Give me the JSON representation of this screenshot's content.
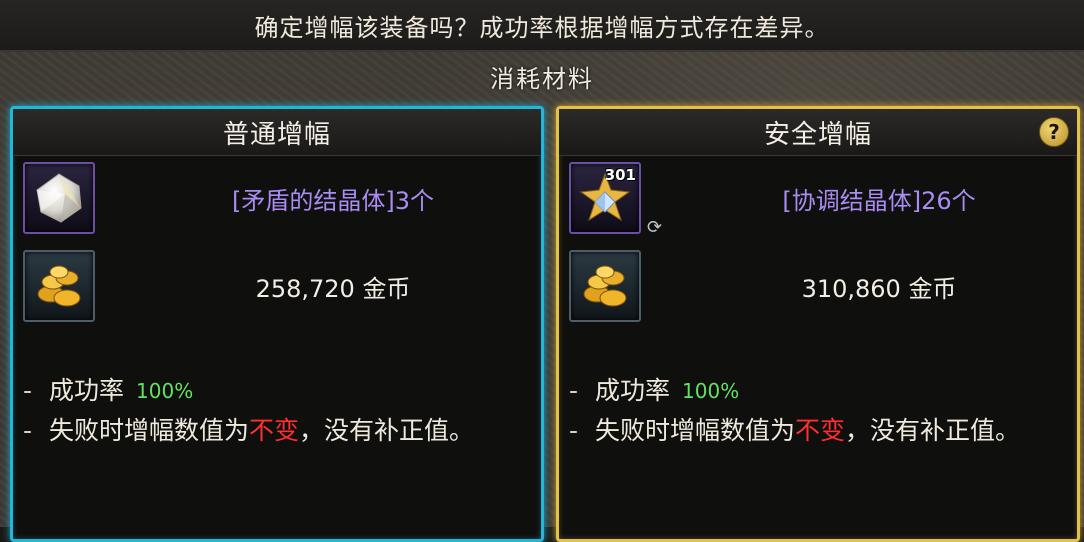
{
  "header": {
    "message": "确定增幅该装备吗？成功率根据增幅方式存在差异。",
    "section_title": "消耗材料"
  },
  "panels": {
    "normal": {
      "title": "普通增幅",
      "material": {
        "name": "[矛盾的结晶体]3个",
        "icon": "crystal-icon"
      },
      "gold": {
        "amount": "258,720 金币",
        "icon": "gold-coins-icon"
      },
      "success_label": "成功率",
      "success_value": "100%",
      "fail_prefix": "失败时增幅数值为",
      "fail_highlight": "不变",
      "fail_suffix": "，没有补正值。"
    },
    "safe": {
      "title": "安全增幅",
      "help_label": "?",
      "material": {
        "name": "[协调结晶体]26个",
        "stack_count": "301",
        "icon": "harmony-crystal-icon"
      },
      "gold": {
        "amount": "310,860 金币",
        "icon": "gold-coins-icon"
      },
      "success_label": "成功率",
      "success_value": "100%",
      "fail_prefix": "失败时增幅数值为",
      "fail_highlight": "不变",
      "fail_suffix": "，没有补正值。"
    }
  },
  "colors": {
    "normal_border": "#22b7d8",
    "safe_border": "#e3c24a",
    "item_name": "#a98bf2",
    "success_green": "#62e25e",
    "warning_red": "#ff2f2f"
  }
}
